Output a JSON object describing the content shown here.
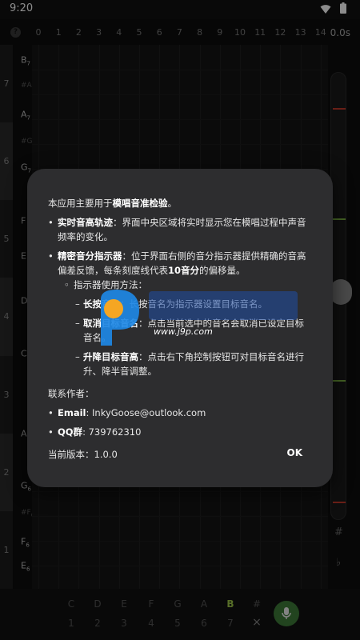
{
  "status_bar": {
    "time": "9:20"
  },
  "top_axis": {
    "ticks": [
      "0",
      "1",
      "2",
      "3",
      "4",
      "5",
      "6",
      "7",
      "8",
      "9",
      "10",
      "11",
      "12",
      "13",
      "14"
    ]
  },
  "time_label": "0.0s",
  "octaves": [
    "7",
    "6",
    "5",
    "4",
    "3",
    "2",
    "1"
  ],
  "notes": [
    {
      "main": "B",
      "sub": "7",
      "sharp": false
    },
    {
      "main": "#A",
      "sub": "7",
      "sharp": true
    },
    {
      "main": "A",
      "sub": "7",
      "sharp": false
    },
    {
      "main": "#G",
      "sub": "7",
      "sharp": true
    },
    {
      "main": "G",
      "sub": "7",
      "sharp": false
    },
    {
      "main": "F",
      "sub": "",
      "sharp": false
    },
    {
      "main": "E",
      "sub": "",
      "sharp": false
    },
    {
      "main": "D",
      "sub": "",
      "sharp": false
    },
    {
      "main": "C",
      "sub": "",
      "sharp": false
    },
    {
      "main": "A",
      "sub": "",
      "sharp": false
    },
    {
      "main": "G",
      "sub": "6",
      "sharp": false
    },
    {
      "main": "#F",
      "sub": "6",
      "sharp": true
    },
    {
      "main": "F",
      "sub": "6",
      "sharp": false
    },
    {
      "main": "E",
      "sub": "6",
      "sharp": false
    }
  ],
  "right_panel": {
    "sharp": "#",
    "flat": "♭"
  },
  "bottom_bar": {
    "notes": [
      "C",
      "D",
      "E",
      "F",
      "G",
      "A",
      "B",
      "#"
    ],
    "selected_note": "B",
    "degrees": [
      "1",
      "2",
      "3",
      "4",
      "5",
      "6",
      "7"
    ],
    "close": "×"
  },
  "dialog": {
    "intro_prefix": "本应用主要用于",
    "intro_bold": "模唱音准检验",
    "intro_suffix": "。",
    "item1_bold": "实时音高轨迹",
    "item1_text": "：界面中央区域将实时显示您在模唱过程中声音频率的变化。",
    "item2_bold": "精密音分指示器",
    "item2_text_a": "：位于界面右侧的音分指示器提供精确的音高偏差反馈，每条刻度线代表",
    "item2_bold2": "10音分",
    "item2_text_b": "的偏移量。",
    "usage_title": "指示器使用方法：",
    "usage1_bold": "长按音名",
    "usage1_text": "：长按音名为指示器设置目标音名。",
    "usage2_bold": "取消目标音名",
    "usage2_text": "：点击当前选中的音名会取消已设定目标音名。",
    "usage3_bold": "升降目标音高",
    "usage3_text": "：点击右下角控制按钮可对目标音名进行升、降半音调整。",
    "contact_title": "联系作者：",
    "email_label": "Email",
    "email_value": ": InkyGoose@outlook.com",
    "qq_label": "QQ群",
    "qq_value": ": 739762310",
    "version": "当前版本：1.0.0",
    "ok": "OK"
  },
  "watermark": {
    "text": "www.j9p.com"
  },
  "colors": {
    "accent_green": "#9ec94a",
    "meter_red": "#c0392b",
    "meter_green": "#7cb342",
    "mic_green": "#3f7d3a"
  }
}
